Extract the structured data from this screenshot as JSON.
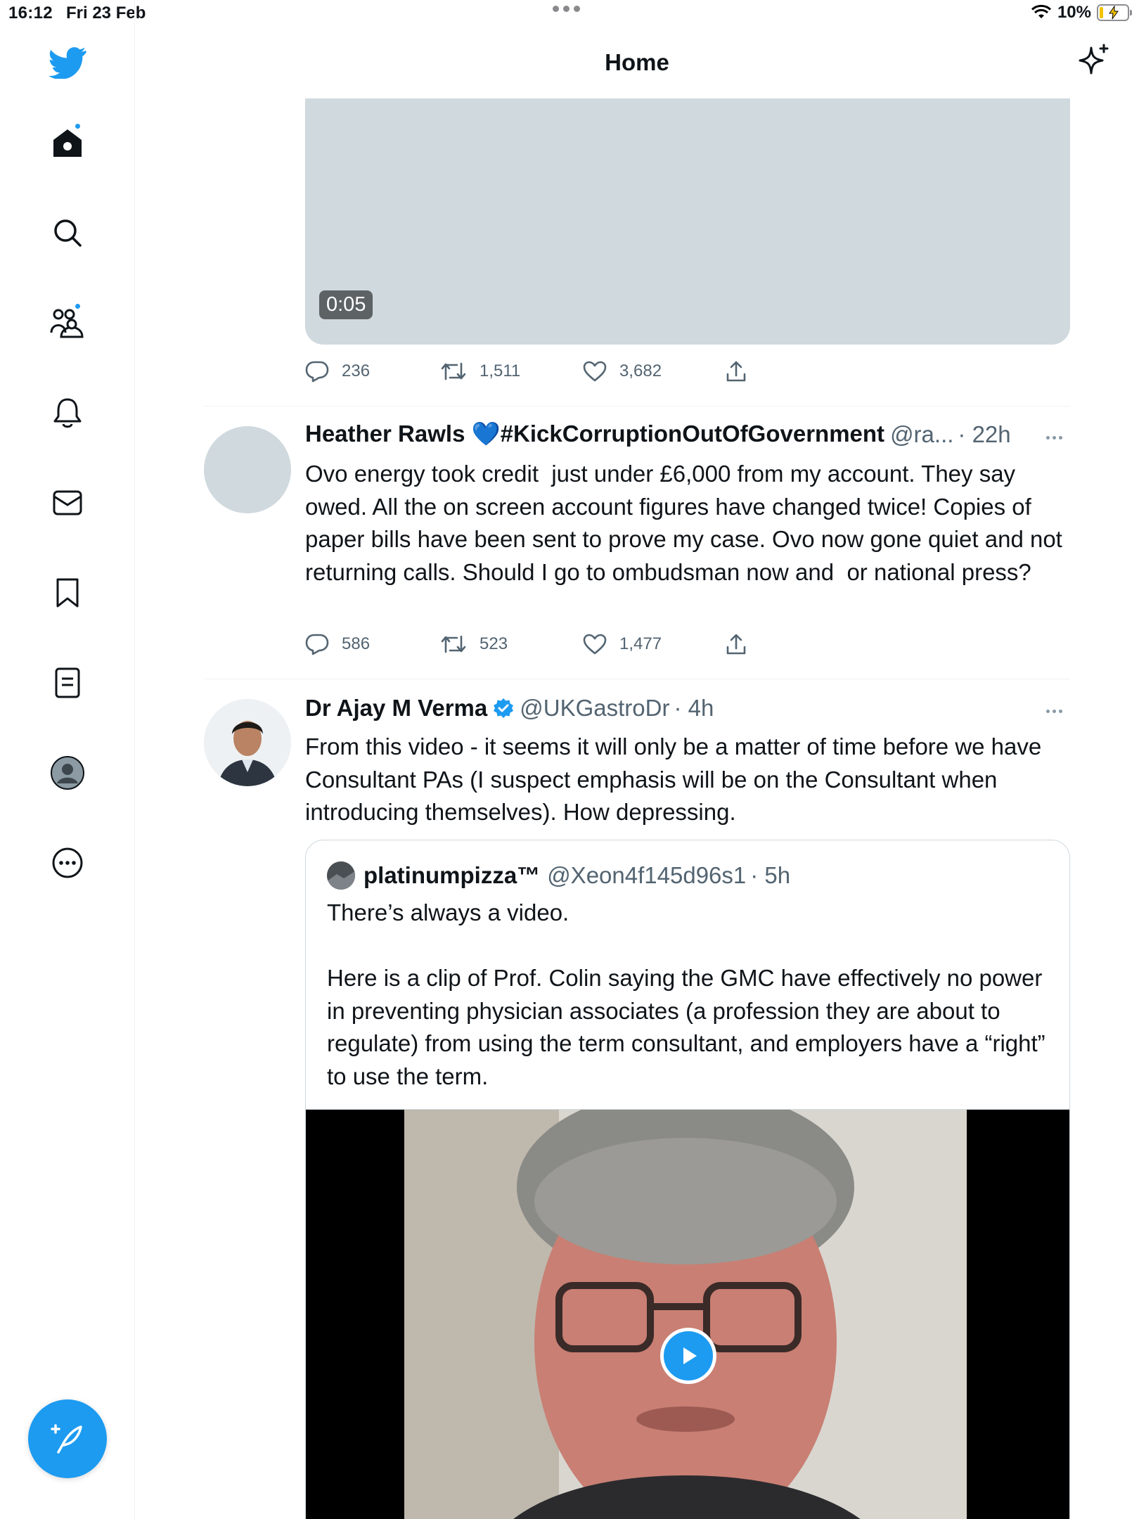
{
  "status_bar": {
    "time": "16:12",
    "date": "Fri 23 Feb",
    "battery": "10%"
  },
  "header": {
    "title": "Home"
  },
  "sidebar": {
    "items": [
      {
        "name": "home"
      },
      {
        "name": "explore"
      },
      {
        "name": "communities"
      },
      {
        "name": "notifications"
      },
      {
        "name": "messages"
      },
      {
        "name": "bookmarks"
      },
      {
        "name": "lists"
      },
      {
        "name": "profile"
      },
      {
        "name": "more"
      }
    ]
  },
  "tweets": [
    {
      "media": {
        "duration": "0:05"
      },
      "replies": "236",
      "retweets": "1,511",
      "likes": "3,682"
    },
    {
      "name": "Heather Rawls 💙#KickCorruptionOutOfGovernment",
      "handle": "@ra...",
      "time": "· 22h",
      "text": "Ovo energy took credit  just under £6,000 from my account. They say owed. All the on screen account figures have changed twice! Copies of paper bills have been sent to prove my case. Ovo now gone quiet and not returning calls. Should I go to ombudsman now and  or national press?",
      "replies": "586",
      "retweets": "523",
      "likes": "1,477"
    },
    {
      "name": "Dr Ajay M Verma",
      "handle": "@UKGastroDr",
      "time": "· 4h",
      "text": "From this video - it seems it will only be a matter of time before we have Consultant PAs (I suspect emphasis will be on the Consultant when introducing themselves). How depressing.",
      "quote": {
        "name": "platinumpizza™",
        "handle": "@Xeon4f145d96s1",
        "time": "· 5h",
        "text": "There’s always a video.\n\nHere is a clip of Prof. Colin saying the GMC have effectively no power in preventing physician associates (a profession they are about to regulate) from using the term consultant, and employers have a “right” to use the term."
      }
    }
  ],
  "colors": {
    "accent": "#1d9bf0",
    "text": "#0f1419",
    "secondary": "#536471",
    "placeholder": "#cfd9de"
  }
}
